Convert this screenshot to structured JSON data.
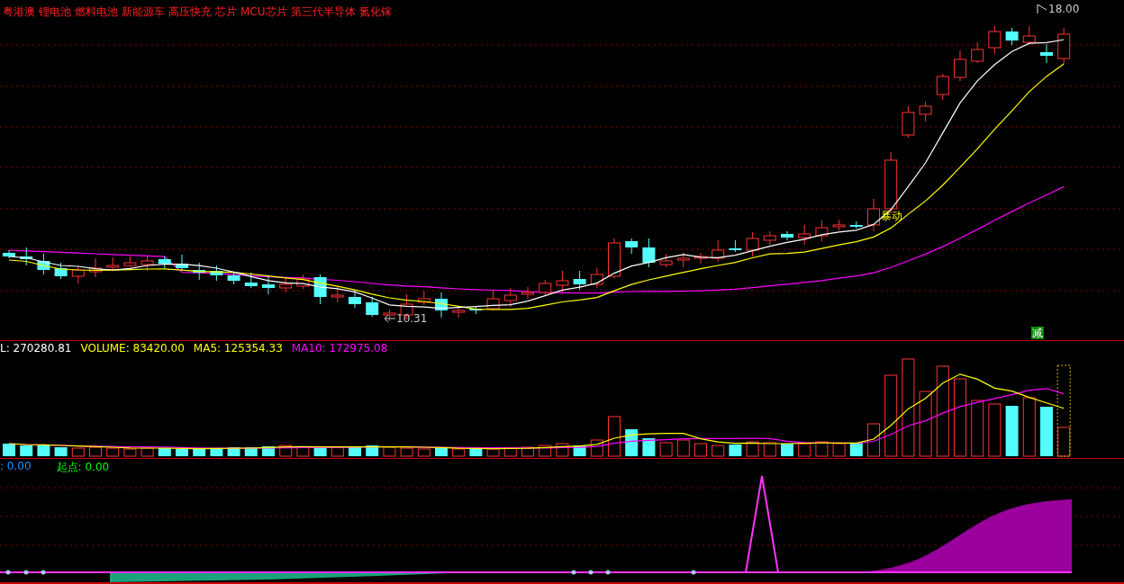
{
  "concept_tags": [
    {
      "text": "粤港澳"
    },
    {
      "text": "锂电池"
    },
    {
      "text": "燃料电池"
    },
    {
      "text": "新能源车"
    },
    {
      "text": "高压快充"
    },
    {
      "text": "芯片"
    },
    {
      "text": "MCU芯片"
    },
    {
      "text": "第三代半导体"
    },
    {
      "text": "氮化镓"
    }
  ],
  "price_panel": {
    "high_label": "18.00",
    "low_label": "10.31",
    "signal_label": "暴动",
    "reduce_badge": "减"
  },
  "volume_panel": {
    "labels": [
      {
        "text": "L: 270280.81",
        "color": "#ffffff"
      },
      {
        "text": "VOLUME: 83420.00",
        "color": "#ffff00"
      },
      {
        "text": "MA5: 125354.33",
        "color": "#ffff00"
      },
      {
        "text": "MA10: 172975.08",
        "color": "#ff00ff"
      }
    ]
  },
  "indicator_panel": {
    "labels": [
      {
        "text": ": 0.00",
        "color": "#1e90ff"
      },
      {
        "text": "起点: 0.00",
        "color": "#00ff00"
      }
    ]
  }
}
